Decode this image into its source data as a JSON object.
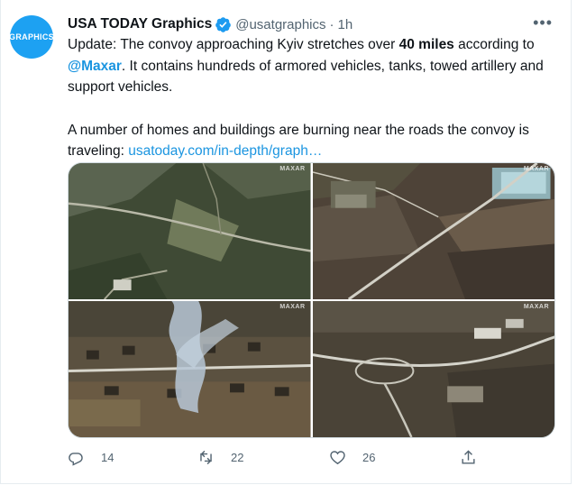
{
  "tweet": {
    "avatar_text": "GRAPHICS",
    "author_name": "USA TODAY Graphics",
    "handle": "@usatgraphics",
    "separator": "·",
    "time": "1h",
    "more_icon": "more-dots-icon",
    "paragraph1": {
      "before_bold": "Update: The convoy approaching Kyiv stretches over ",
      "bold": "40 miles",
      "after_bold": " according to ",
      "mention": "@Maxar",
      "after_mention": ". It contains hundreds of armored vehicles, tanks, towed artillery and support vehicles."
    },
    "paragraph2": {
      "text": "A number of homes and buildings are burning near the roads the convoy is traveling: ",
      "link": "usatoday.com/in-depth/graph…"
    },
    "media": {
      "watermark": "MAXAR",
      "images": [
        "convoy-forest-road",
        "convoy-farmland-road",
        "burning-homes-smoke",
        "convoy-interchange"
      ]
    },
    "actions": {
      "reply_count": "14",
      "retweet_count": "22",
      "like_count": "26"
    },
    "colors": {
      "accent": "#1da1f2",
      "link": "#1b95e0",
      "muted": "#536471"
    }
  }
}
